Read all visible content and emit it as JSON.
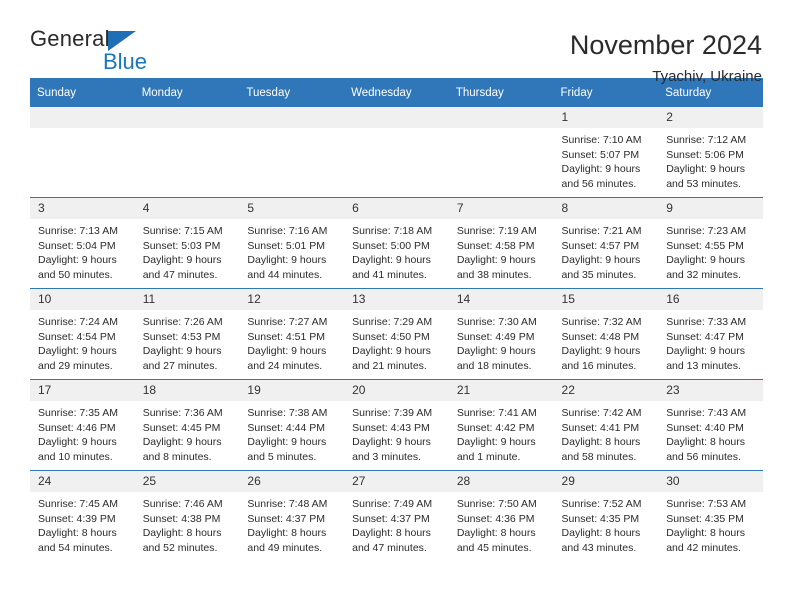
{
  "brand": {
    "name_part1": "General",
    "name_part2": "Blue"
  },
  "header": {
    "title": "November 2024",
    "subtitle": "Tyachiv, Ukraine"
  },
  "colors": {
    "header_blue": "#2f77b8",
    "daynum_gray": "#f0f0f0",
    "logo_blue": "#1878bd"
  },
  "weekday_headers": [
    "Sunday",
    "Monday",
    "Tuesday",
    "Wednesday",
    "Thursday",
    "Friday",
    "Saturday"
  ],
  "weeks": [
    [
      {
        "day": "",
        "blank": true
      },
      {
        "day": "",
        "blank": true
      },
      {
        "day": "",
        "blank": true
      },
      {
        "day": "",
        "blank": true
      },
      {
        "day": "",
        "blank": true
      },
      {
        "day": "1",
        "sunrise": "Sunrise: 7:10 AM",
        "sunset": "Sunset: 5:07 PM",
        "daylight_line1": "Daylight: 9 hours",
        "daylight_line2": "and 56 minutes."
      },
      {
        "day": "2",
        "sunrise": "Sunrise: 7:12 AM",
        "sunset": "Sunset: 5:06 PM",
        "daylight_line1": "Daylight: 9 hours",
        "daylight_line2": "and 53 minutes."
      }
    ],
    [
      {
        "day": "3",
        "sunrise": "Sunrise: 7:13 AM",
        "sunset": "Sunset: 5:04 PM",
        "daylight_line1": "Daylight: 9 hours",
        "daylight_line2": "and 50 minutes."
      },
      {
        "day": "4",
        "sunrise": "Sunrise: 7:15 AM",
        "sunset": "Sunset: 5:03 PM",
        "daylight_line1": "Daylight: 9 hours",
        "daylight_line2": "and 47 minutes."
      },
      {
        "day": "5",
        "sunrise": "Sunrise: 7:16 AM",
        "sunset": "Sunset: 5:01 PM",
        "daylight_line1": "Daylight: 9 hours",
        "daylight_line2": "and 44 minutes."
      },
      {
        "day": "6",
        "sunrise": "Sunrise: 7:18 AM",
        "sunset": "Sunset: 5:00 PM",
        "daylight_line1": "Daylight: 9 hours",
        "daylight_line2": "and 41 minutes."
      },
      {
        "day": "7",
        "sunrise": "Sunrise: 7:19 AM",
        "sunset": "Sunset: 4:58 PM",
        "daylight_line1": "Daylight: 9 hours",
        "daylight_line2": "and 38 minutes."
      },
      {
        "day": "8",
        "sunrise": "Sunrise: 7:21 AM",
        "sunset": "Sunset: 4:57 PM",
        "daylight_line1": "Daylight: 9 hours",
        "daylight_line2": "and 35 minutes."
      },
      {
        "day": "9",
        "sunrise": "Sunrise: 7:23 AM",
        "sunset": "Sunset: 4:55 PM",
        "daylight_line1": "Daylight: 9 hours",
        "daylight_line2": "and 32 minutes."
      }
    ],
    [
      {
        "day": "10",
        "sunrise": "Sunrise: 7:24 AM",
        "sunset": "Sunset: 4:54 PM",
        "daylight_line1": "Daylight: 9 hours",
        "daylight_line2": "and 29 minutes."
      },
      {
        "day": "11",
        "sunrise": "Sunrise: 7:26 AM",
        "sunset": "Sunset: 4:53 PM",
        "daylight_line1": "Daylight: 9 hours",
        "daylight_line2": "and 27 minutes."
      },
      {
        "day": "12",
        "sunrise": "Sunrise: 7:27 AM",
        "sunset": "Sunset: 4:51 PM",
        "daylight_line1": "Daylight: 9 hours",
        "daylight_line2": "and 24 minutes."
      },
      {
        "day": "13",
        "sunrise": "Sunrise: 7:29 AM",
        "sunset": "Sunset: 4:50 PM",
        "daylight_line1": "Daylight: 9 hours",
        "daylight_line2": "and 21 minutes."
      },
      {
        "day": "14",
        "sunrise": "Sunrise: 7:30 AM",
        "sunset": "Sunset: 4:49 PM",
        "daylight_line1": "Daylight: 9 hours",
        "daylight_line2": "and 18 minutes."
      },
      {
        "day": "15",
        "sunrise": "Sunrise: 7:32 AM",
        "sunset": "Sunset: 4:48 PM",
        "daylight_line1": "Daylight: 9 hours",
        "daylight_line2": "and 16 minutes."
      },
      {
        "day": "16",
        "sunrise": "Sunrise: 7:33 AM",
        "sunset": "Sunset: 4:47 PM",
        "daylight_line1": "Daylight: 9 hours",
        "daylight_line2": "and 13 minutes."
      }
    ],
    [
      {
        "day": "17",
        "sunrise": "Sunrise: 7:35 AM",
        "sunset": "Sunset: 4:46 PM",
        "daylight_line1": "Daylight: 9 hours",
        "daylight_line2": "and 10 minutes."
      },
      {
        "day": "18",
        "sunrise": "Sunrise: 7:36 AM",
        "sunset": "Sunset: 4:45 PM",
        "daylight_line1": "Daylight: 9 hours",
        "daylight_line2": "and 8 minutes."
      },
      {
        "day": "19",
        "sunrise": "Sunrise: 7:38 AM",
        "sunset": "Sunset: 4:44 PM",
        "daylight_line1": "Daylight: 9 hours",
        "daylight_line2": "and 5 minutes."
      },
      {
        "day": "20",
        "sunrise": "Sunrise: 7:39 AM",
        "sunset": "Sunset: 4:43 PM",
        "daylight_line1": "Daylight: 9 hours",
        "daylight_line2": "and 3 minutes."
      },
      {
        "day": "21",
        "sunrise": "Sunrise: 7:41 AM",
        "sunset": "Sunset: 4:42 PM",
        "daylight_line1": "Daylight: 9 hours",
        "daylight_line2": "and 1 minute."
      },
      {
        "day": "22",
        "sunrise": "Sunrise: 7:42 AM",
        "sunset": "Sunset: 4:41 PM",
        "daylight_line1": "Daylight: 8 hours",
        "daylight_line2": "and 58 minutes."
      },
      {
        "day": "23",
        "sunrise": "Sunrise: 7:43 AM",
        "sunset": "Sunset: 4:40 PM",
        "daylight_line1": "Daylight: 8 hours",
        "daylight_line2": "and 56 minutes."
      }
    ],
    [
      {
        "day": "24",
        "sunrise": "Sunrise: 7:45 AM",
        "sunset": "Sunset: 4:39 PM",
        "daylight_line1": "Daylight: 8 hours",
        "daylight_line2": "and 54 minutes."
      },
      {
        "day": "25",
        "sunrise": "Sunrise: 7:46 AM",
        "sunset": "Sunset: 4:38 PM",
        "daylight_line1": "Daylight: 8 hours",
        "daylight_line2": "and 52 minutes."
      },
      {
        "day": "26",
        "sunrise": "Sunrise: 7:48 AM",
        "sunset": "Sunset: 4:37 PM",
        "daylight_line1": "Daylight: 8 hours",
        "daylight_line2": "and 49 minutes."
      },
      {
        "day": "27",
        "sunrise": "Sunrise: 7:49 AM",
        "sunset": "Sunset: 4:37 PM",
        "daylight_line1": "Daylight: 8 hours",
        "daylight_line2": "and 47 minutes."
      },
      {
        "day": "28",
        "sunrise": "Sunrise: 7:50 AM",
        "sunset": "Sunset: 4:36 PM",
        "daylight_line1": "Daylight: 8 hours",
        "daylight_line2": "and 45 minutes."
      },
      {
        "day": "29",
        "sunrise": "Sunrise: 7:52 AM",
        "sunset": "Sunset: 4:35 PM",
        "daylight_line1": "Daylight: 8 hours",
        "daylight_line2": "and 43 minutes."
      },
      {
        "day": "30",
        "sunrise": "Sunrise: 7:53 AM",
        "sunset": "Sunset: 4:35 PM",
        "daylight_line1": "Daylight: 8 hours",
        "daylight_line2": "and 42 minutes."
      }
    ]
  ]
}
